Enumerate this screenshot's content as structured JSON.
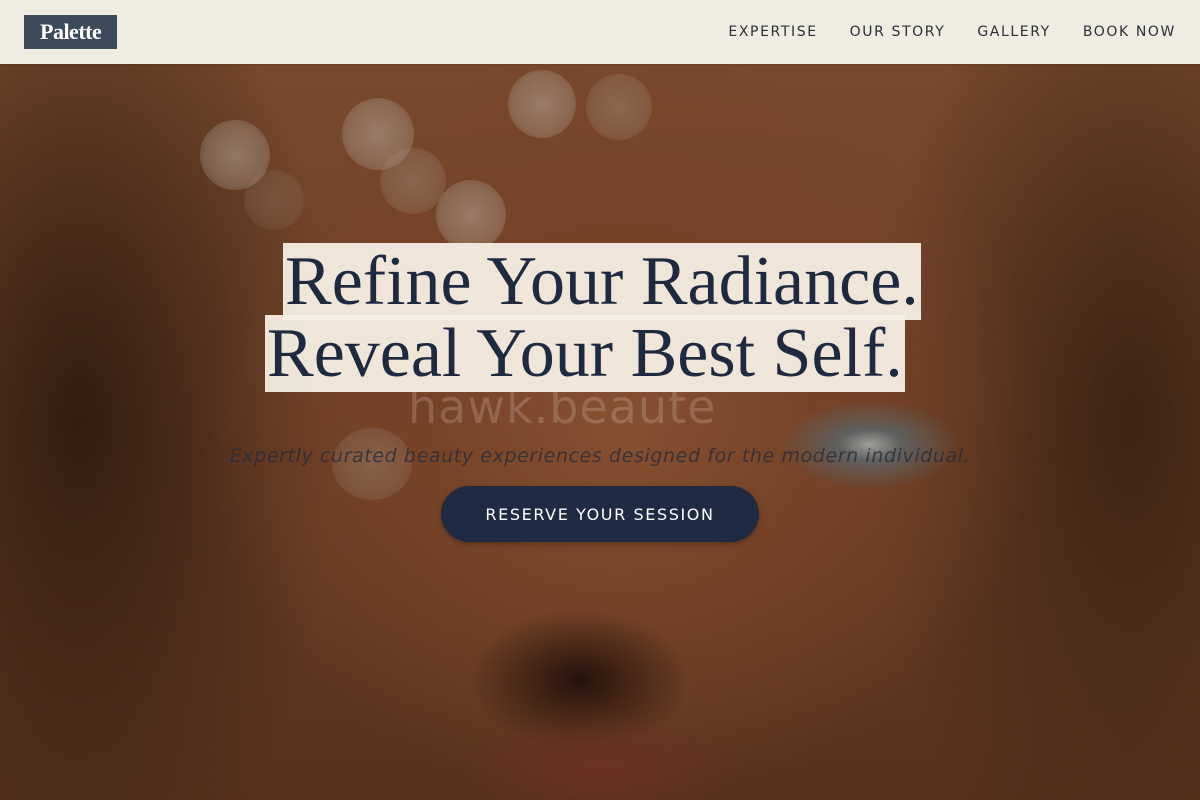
{
  "brand": {
    "logo_text": "Palette"
  },
  "nav": {
    "items": [
      {
        "label": "EXPERTISE"
      },
      {
        "label": "OUR STORY"
      },
      {
        "label": "GALLERY"
      },
      {
        "label": "BOOK NOW"
      }
    ]
  },
  "hero": {
    "title_line_1": "Refine Your Radiance.",
    "title_line_2": "Reveal Your Best Self.",
    "subtitle": "Expertly curated beauty experiences designed for the modern individual.",
    "cta_label": "RESERVE YOUR SESSION",
    "watermark_text": "hawk.beaute"
  },
  "colors": {
    "header_bg": "#efece2",
    "logo_bg": "#3d4a5c",
    "title_color": "#1f2a40",
    "title_highlight": "#f6f0e4",
    "cta_bg": "#1f2b42",
    "cta_text": "#ffffff"
  }
}
